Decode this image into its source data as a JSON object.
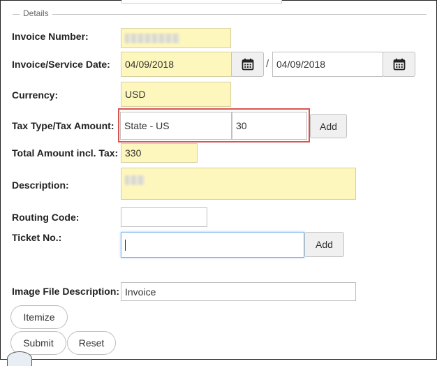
{
  "section": {
    "legend": "Details"
  },
  "invoice_number": {
    "label": "Invoice Number:",
    "value": ""
  },
  "service_date": {
    "label": "Invoice/Service Date:",
    "from": "04/09/2018",
    "separator": "/",
    "to": "04/09/2018",
    "icon": "calendar-icon"
  },
  "currency": {
    "label": "Currency:",
    "value": "USD"
  },
  "tax": {
    "label": "Tax Type/Tax Amount:",
    "type": "State - US",
    "amount": "30",
    "add_label": "Add"
  },
  "total": {
    "label": "Total Amount incl. Tax:",
    "value": "330"
  },
  "description": {
    "label": "Description:",
    "value": ""
  },
  "routing_code": {
    "label": "Routing Code:",
    "value": ""
  },
  "ticket": {
    "label": "Ticket No.:",
    "value": "",
    "add_label": "Add"
  },
  "image_file": {
    "label": "Image File Description:",
    "value": "Invoice"
  },
  "buttons": {
    "itemize": "Itemize",
    "submit": "Submit",
    "reset": "Reset"
  },
  "colors": {
    "highlight_box": "#d9534f",
    "required_field": "#fef7bd"
  }
}
